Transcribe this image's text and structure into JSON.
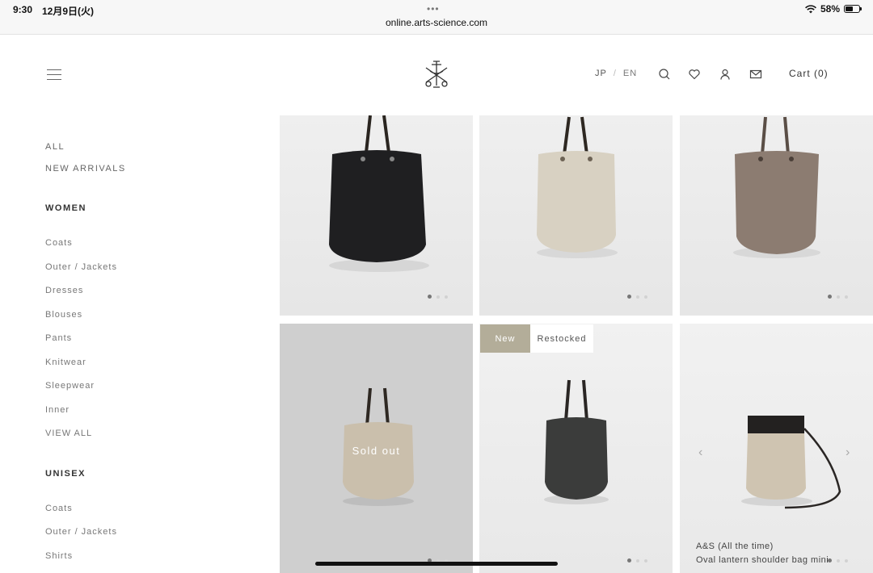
{
  "status_bar": {
    "time": "9:30",
    "date": "12月9日(火)",
    "battery": "58%",
    "battery_level": 0.58,
    "url": "online.arts-science.com",
    "tab_dots": "•••"
  },
  "header": {
    "logo_icon": "arts-and-science-logo-icon",
    "lang_jp": "JP",
    "lang_sep": "/",
    "lang_en": "EN",
    "cart_label": "Cart (0)"
  },
  "sidebar": {
    "top_links": [
      "ALL",
      "NEW ARRIVALS"
    ],
    "women": {
      "heading": "WOMEN",
      "items": [
        "Coats",
        "Outer / Jackets",
        "Dresses",
        "Blouses",
        "Pants",
        "Knitwear",
        "Sleepwear",
        "Inner",
        "VIEW ALL"
      ]
    },
    "unisex": {
      "heading": "UNISEX",
      "items": [
        "Coats",
        "Outer / Jackets",
        "Shirts"
      ]
    }
  },
  "products": {
    "card4_overlay": "Sold out",
    "card5_tags": {
      "new": "New",
      "restocked": "Restocked"
    },
    "card6_brand": "A&S (All the time)",
    "card6_name": "Oval lantern shoulder bag mini",
    "prev_arrow": "‹",
    "next_arrow": "›"
  }
}
